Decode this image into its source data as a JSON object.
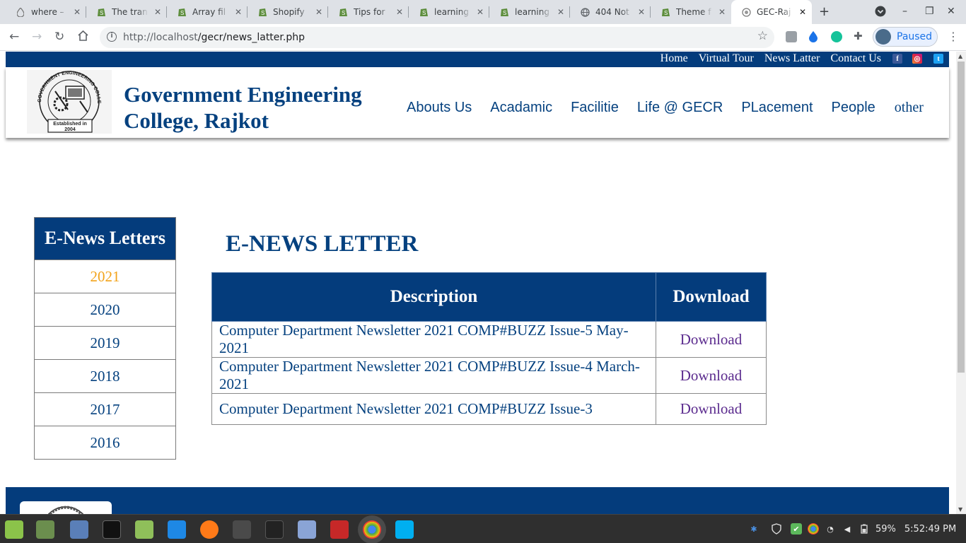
{
  "browser": {
    "tabs": [
      {
        "title": "where –",
        "icon": "water-drop-icon"
      },
      {
        "title": "The tran",
        "icon": "shopify-icon"
      },
      {
        "title": "Array fil",
        "icon": "shopify-icon"
      },
      {
        "title": "Shopify",
        "icon": "shopify-icon"
      },
      {
        "title": "Tips for",
        "icon": "shopify-icon"
      },
      {
        "title": "learning",
        "icon": "shopify-icon"
      },
      {
        "title": "learning",
        "icon": "shopify-icon"
      },
      {
        "title": "404 Not",
        "icon": "globe-icon"
      },
      {
        "title": "Theme f",
        "icon": "shopify-icon"
      },
      {
        "title": "GEC-Raj",
        "icon": "college-logo-icon",
        "active": true
      }
    ],
    "url_host": "http://localhost",
    "url_path": "/gecr/news_latter.php",
    "profile_label": "Paused"
  },
  "site": {
    "topnav": [
      "Home",
      "Virtual Tour",
      "News Latter",
      "Contact Us"
    ],
    "social": [
      "facebook-icon",
      "instagram-icon",
      "twitter-icon"
    ],
    "college_name": "Government Engineering College, Rajkot",
    "logo_text": {
      "ring": "GOVERNMENT ENGINEERING COLLEGE RAJKOT",
      "established": "Established in",
      "year": "2004"
    },
    "mainnav": [
      "Abouts Us",
      "Acadamic",
      "Facilitie",
      "Life @ GECR",
      "PLacement",
      "People",
      "other"
    ]
  },
  "sidebar": {
    "title": "E-News Letters",
    "years": [
      "2021",
      "2020",
      "2019",
      "2018",
      "2017",
      "2016"
    ],
    "active_year": "2021"
  },
  "main": {
    "title": "E-NEWS LETTER",
    "columns": [
      "Description",
      "Download"
    ],
    "rows": [
      {
        "description": "Computer Department Newsletter 2021 COMP#BUZZ Issue-5 May-2021",
        "download": "Download"
      },
      {
        "description": "Computer Department Newsletter 2021 COMP#BUZZ Issue-4 March-2021",
        "download": "Download"
      },
      {
        "description": "Computer Department Newsletter 2021 COMP#BUZZ Issue-3",
        "download": "Download"
      }
    ]
  },
  "taskbar": {
    "apps": [
      "mint-menu-icon",
      "files-icon",
      "screenshot-icon",
      "terminal-icon",
      "folder-icon",
      "vscode-icon",
      "firefox-icon",
      "sublime-icon",
      "terminal-alt-icon",
      "mail-icon",
      "filezilla-icon",
      "chrome-icon",
      "skype-icon"
    ],
    "battery": "59%",
    "time": "5:52:49 PM"
  },
  "colors": {
    "brand_navy": "#043c7c",
    "brand_text": "#05417f",
    "active_year": "#f2a31a",
    "visited_link": "#5b2b8e"
  }
}
